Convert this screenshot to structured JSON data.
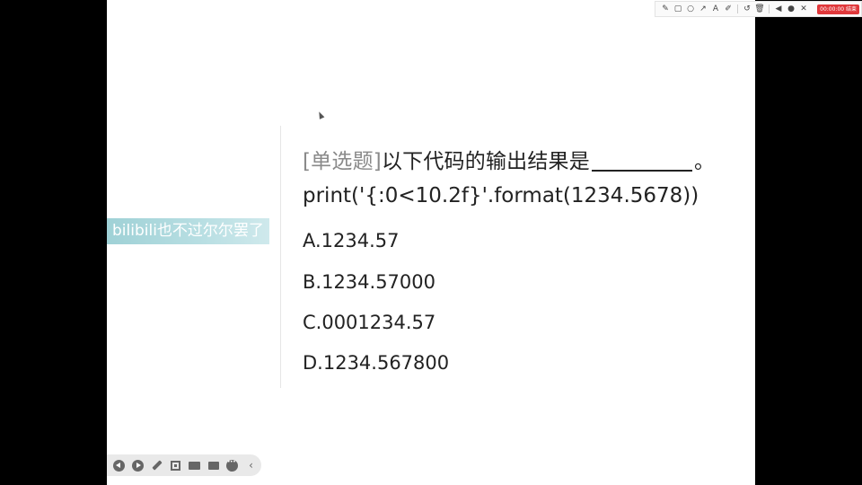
{
  "toolbar": {
    "tools": [
      "pencil-icon",
      "rectangle-icon",
      "circle-icon",
      "arrow-icon",
      "text-icon",
      "marker-icon",
      "undo-icon",
      "trash-icon",
      "speaker-icon",
      "mic-icon",
      "close-icon"
    ],
    "record_label": "00:00:00 结束"
  },
  "watermark": {
    "text": "bilibili也不过尔尔罢了"
  },
  "question": {
    "type": "[单选题]",
    "text": "以下代码的输出结果是",
    "end": "。",
    "code": "print('{:0<10.2f}'.format(1234.5678))"
  },
  "options": [
    {
      "label": "A.1234.57"
    },
    {
      "label": "B.1234.57000"
    },
    {
      "label": "C.0001234.57"
    },
    {
      "label": "D.1234.567800"
    }
  ],
  "player": {
    "buttons": [
      "prev-icon",
      "next-icon",
      "pen-icon",
      "screenshot-icon",
      "camera-icon",
      "chat-icon",
      "more-icon",
      "collapse-icon"
    ]
  },
  "colors": {
    "watermark_bg": "#a8d6db",
    "record_bg": "#e0383b",
    "type_text": "#8a8a8a"
  }
}
